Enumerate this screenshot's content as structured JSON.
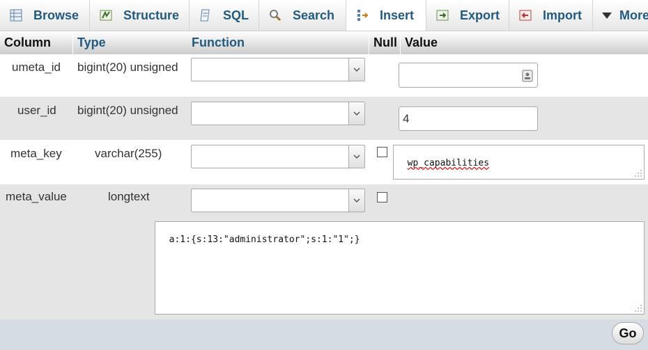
{
  "tabs": [
    {
      "label": "Browse",
      "icon": "browse-icon"
    },
    {
      "label": "Structure",
      "icon": "structure-icon"
    },
    {
      "label": "SQL",
      "icon": "sql-icon"
    },
    {
      "label": "Search",
      "icon": "search-icon"
    },
    {
      "label": "Insert",
      "icon": "insert-icon",
      "active": true
    },
    {
      "label": "Export",
      "icon": "export-icon"
    },
    {
      "label": "Import",
      "icon": "import-icon"
    },
    {
      "label": "More",
      "icon": "more-icon"
    }
  ],
  "header": {
    "column": "Column",
    "type": "Type",
    "function": "Function",
    "null": "Null",
    "value": "Value"
  },
  "rows": [
    {
      "column": "umeta_id",
      "type": "bigint(20) unsigned",
      "value": ""
    },
    {
      "column": "user_id",
      "type": "bigint(20) unsigned",
      "value": "4"
    },
    {
      "column": "meta_key",
      "type": "varchar(255)",
      "value": "wp_capabilities"
    },
    {
      "column": "meta_value",
      "type": "longtext",
      "value": "a:1:{s:13:\"administrator\";s:1:\"1\";}"
    }
  ],
  "go_label": "Go",
  "colors": {
    "tab_text": "#235a81",
    "row_alt": "#e5e5e5",
    "footer": "#d5dce4"
  }
}
